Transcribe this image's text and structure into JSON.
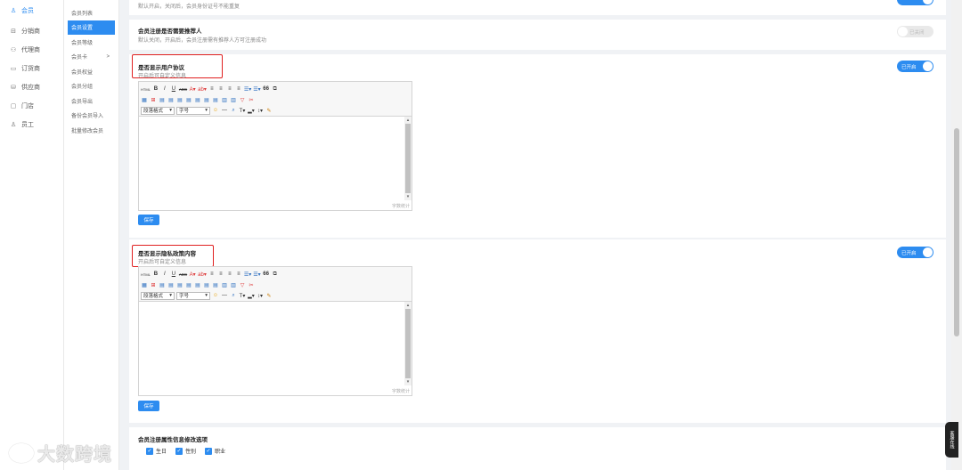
{
  "sidebar": {
    "items": [
      {
        "label": "会员",
        "icon": "user-icon",
        "glyph": "♙",
        "active": true
      },
      {
        "label": "分销商",
        "icon": "distributor-icon",
        "glyph": "⊟",
        "active": false
      },
      {
        "label": "代理商",
        "icon": "agent-icon",
        "glyph": "⚇",
        "active": false
      },
      {
        "label": "订货商",
        "icon": "order-icon",
        "glyph": "▭",
        "active": false
      },
      {
        "label": "供应商",
        "icon": "supplier-icon",
        "glyph": "⛁",
        "active": false
      },
      {
        "label": "门店",
        "icon": "store-icon",
        "glyph": "▢",
        "active": false
      },
      {
        "label": "员工",
        "icon": "staff-icon",
        "glyph": "♙",
        "active": false
      }
    ]
  },
  "subnav": {
    "items": [
      {
        "label": "会员列表",
        "active": false
      },
      {
        "label": "会员设置",
        "active": true
      },
      {
        "label": "会员等级",
        "active": false
      },
      {
        "label": "会员卡",
        "active": false,
        "arrow": ">"
      },
      {
        "label": "会员权益",
        "active": false
      },
      {
        "label": "会员分组",
        "active": false
      },
      {
        "label": "会员导出",
        "active": false
      },
      {
        "label": "备份会员导入",
        "active": false
      },
      {
        "label": "批量修改会员",
        "active": false
      }
    ]
  },
  "settings": {
    "top_desc": "默认开启，关闭后，会员身份证号不能重复",
    "referrer": {
      "title": "会员注册是否需要推荐人",
      "desc": "默认关闭，开启后，会员注册需有推荐人方可注册成功",
      "toggle": "已关闭"
    },
    "agreement": {
      "title": "是否显示用户协议",
      "desc": "开启后可自定义信息",
      "toggle": "已开启",
      "save": "保存",
      "wordcount": "字数统计"
    },
    "privacy": {
      "title": "是否显示隐私政策内容",
      "desc": "开启后可自定义信息",
      "toggle": "已开启",
      "save": "保存",
      "wordcount": "字数统计"
    },
    "attributes": {
      "title": "会员注册属性信息修改选项",
      "options": [
        {
          "label": "生日",
          "checked": true
        },
        {
          "label": "性别",
          "checked": true
        },
        {
          "label": "职业",
          "checked": true
        }
      ]
    }
  },
  "editor": {
    "toolbar_row1": [
      "HTML",
      "B",
      "I",
      "U",
      "ABC",
      "A▾",
      "ab▾",
      "≡",
      "≡",
      "≡",
      "≡",
      "☰▾",
      "☰▾",
      "66",
      "⧉"
    ],
    "toolbar_row2": [
      "▦",
      "⊞",
      "▤",
      "▤",
      "▤",
      "▤",
      "▤",
      "▤",
      "▤",
      "▥",
      "▥",
      "▽",
      "✂"
    ],
    "paragraph_select": "段落格式",
    "fontsize_select": "字号",
    "toolbar_row3_tail": [
      "☺",
      "—",
      "⌕",
      "T▾",
      "▂▾",
      "↕▾",
      "✎"
    ]
  },
  "customer_service": "客服在线",
  "watermark": "大数跨境"
}
